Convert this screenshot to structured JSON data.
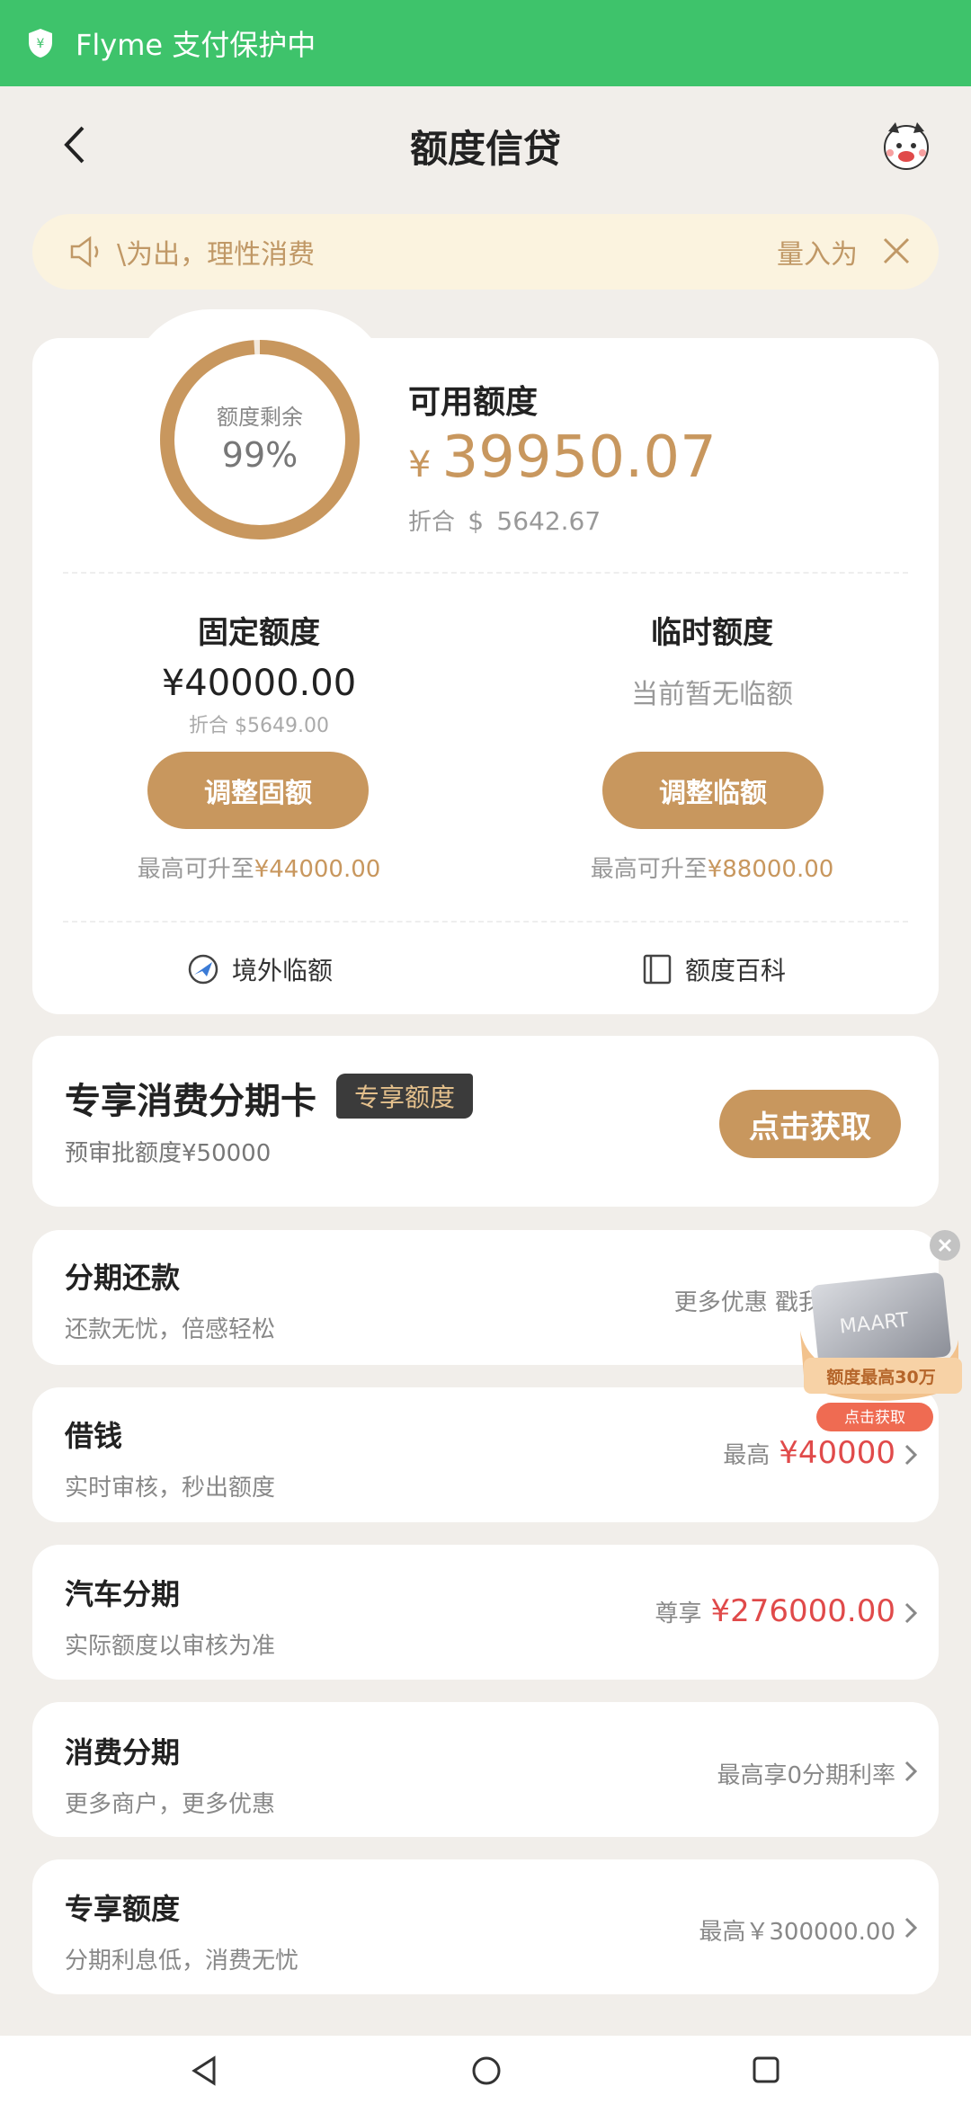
{
  "status": {
    "text": "Flyme 支付保护中"
  },
  "nav": {
    "title": "额度信贷"
  },
  "notice": {
    "text_a": "\\为出，理性消费",
    "text_b": "量入为"
  },
  "quota": {
    "ring_label": "额度剩余",
    "ring_percent": "99%",
    "ring_fraction": 0.99,
    "available_title": "可用额度",
    "currency": "¥",
    "available_amount": "39950.07",
    "usd_prefix": "折合",
    "usd_symbol": "$",
    "usd_amount": "5642.67"
  },
  "fixed": {
    "title": "固定额度",
    "amount": "¥40000.00",
    "usd": "折合 $5649.00",
    "button": "调整固额",
    "upgrade_prefix": "最高可升至",
    "upgrade_value": "¥44000.00"
  },
  "temp": {
    "title": "临时额度",
    "none": "当前暂无临额",
    "button": "调整临额",
    "upgrade_prefix": "最高可升至",
    "upgrade_value": "¥88000.00"
  },
  "links": {
    "overseas": "境外临额",
    "wiki": "额度百科"
  },
  "installment_card": {
    "title": "专享消费分期卡",
    "badge": "专享额度",
    "subtitle": "预审批额度¥50000",
    "button": "点击获取"
  },
  "rows": [
    {
      "title": "分期还款",
      "sub": "还款无忧，倍感轻松",
      "right_text": "更多优惠 戳我查",
      "right_value": ""
    },
    {
      "title": "借钱",
      "sub": "实时审核，秒出额度",
      "right_text": "最高",
      "right_value": "¥40000"
    },
    {
      "title": "汽车分期",
      "sub": "实际额度以审核为准",
      "right_text": "尊享",
      "right_value": "¥276000.00"
    },
    {
      "title": "消费分期",
      "sub": "更多商户，更多优惠",
      "right_text": "最高享0分期利率",
      "right_value": ""
    },
    {
      "title": "专享额度",
      "sub": "分期利息低，消费无忧",
      "right_text": "最高￥300000.00",
      "right_value": ""
    }
  ],
  "float_ad": {
    "line1": "额度最高30万",
    "button": "点击获取",
    "card_text": "MAART"
  },
  "colors": {
    "green": "#3ec36b",
    "gold": "#c8975e",
    "red": "#e04a4a"
  }
}
